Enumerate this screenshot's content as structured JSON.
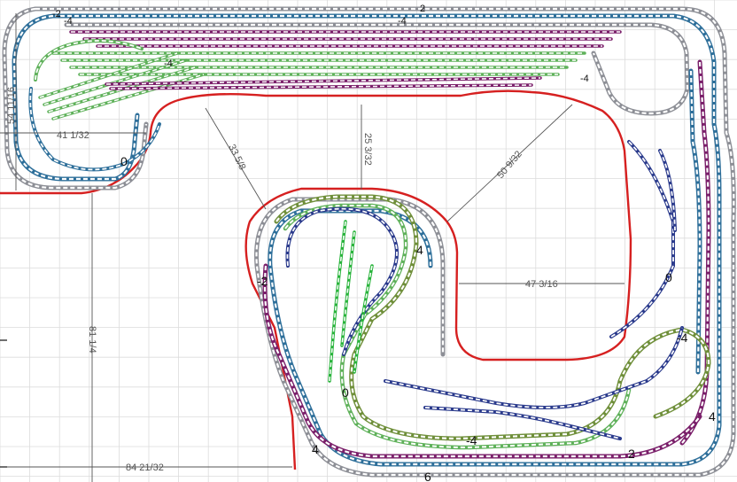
{
  "colors": {
    "grid": "#dcdcdc",
    "wall": "#d62020",
    "track_gray": "#8d8f96",
    "track_blue": "#2e6f9a",
    "track_navy": "#2a3a8c",
    "track_purple": "#7a1f6a",
    "track_green": "#5fb15a",
    "track_olive": "#6f8f3a",
    "track_bright_green": "#27b33a",
    "dimension": "#555555"
  },
  "dimensions": {
    "top_left_height": "54 11/16",
    "top_left_width": "41 1/32",
    "peninsula_diagonal": "33 5/8",
    "aisle_width": "25 3/32",
    "diagonal_right": "50 9/32",
    "right_aisle": "47 3/16",
    "left_height": "81 1/4",
    "bottom_width": "84 21/32"
  },
  "elevations": {
    "top_left_a": "-2",
    "top_left_b": "-4",
    "top_mid_a": "-4",
    "top_mid_b": "2",
    "yard_left": "-4",
    "yard_right": "-4",
    "left_loop": "0",
    "peninsula_left": "-2",
    "peninsula_top": "4",
    "peninsula_center": "0",
    "bottom_left": "4",
    "bottom_mid": "-4",
    "bottom_low": "6",
    "bottom_right": "2",
    "right_upper": "0",
    "right_mid": "-4",
    "right_lower": "4"
  }
}
